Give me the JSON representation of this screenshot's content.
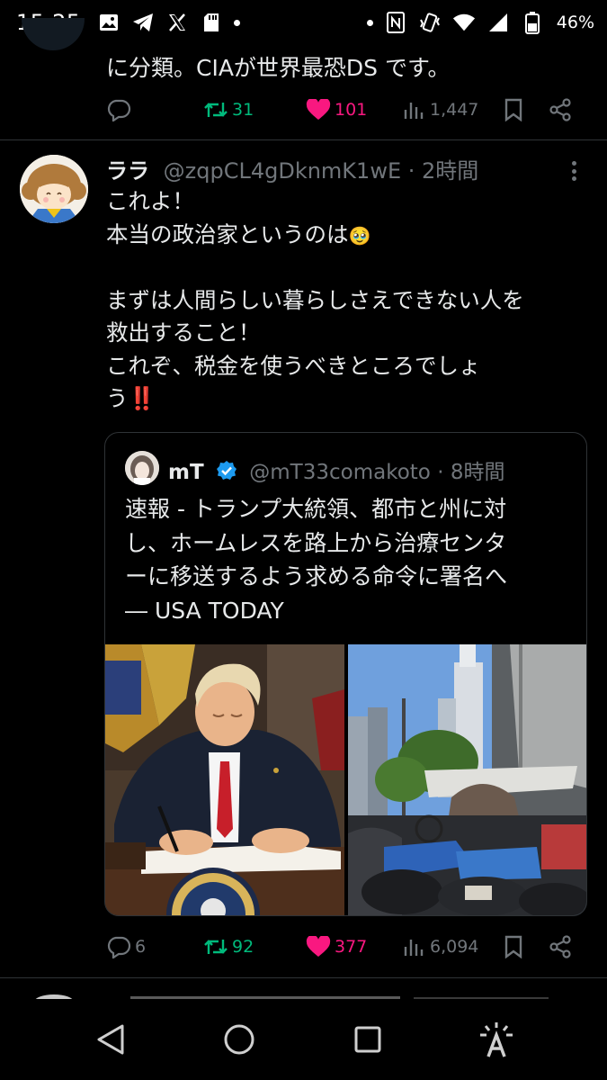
{
  "status_bar": {
    "time": "15:25",
    "battery_percent": "46%",
    "left_icons": [
      "gallery-icon",
      "telegram-icon",
      "x-icon",
      "sd-card-icon",
      "dot"
    ],
    "right_icons": [
      "dot",
      "nfc-icon",
      "vibrate-icon",
      "wifi-icon",
      "signal-icon",
      "battery-icon"
    ]
  },
  "previous_tweet": {
    "text_tail": "に分類。CIAが世界最恐DS です。",
    "retweets": "31",
    "likes": "101",
    "views": "1,447"
  },
  "tweet": {
    "display_name": "ララ",
    "handle_meta": "@zqpCL4gDknmK1wE · 2時間",
    "lines": [
      "これよ！",
      "本当の政治家というのは",
      "",
      "まずは人間らしい暮らしさえできない人を",
      "救出すること！",
      "これぞ、税金を使うべきところでしょ",
      "う"
    ],
    "tear_emoji": "🥹",
    "exclaim_emoji": "‼️",
    "replies": "6",
    "retweets": "92",
    "likes": "377",
    "views": "6,094"
  },
  "quote": {
    "display_name": "mT",
    "handle_meta": "@mT33comakoto · 8時間",
    "lines": [
      "速報 - トランプ大統領、都市と州に対",
      "し、ホームレスを路上から治療センタ",
      "ーに移送するよう求める命令に署名へ",
      "― USA TODAY"
    ]
  },
  "colors": {
    "background": "#000000",
    "text": "#e7e9ea",
    "muted": "#71767b",
    "retweet_green": "#00ba7c",
    "like_pink": "#f91880",
    "verified_blue": "#1d9bf0",
    "divider": "#2f3336"
  }
}
